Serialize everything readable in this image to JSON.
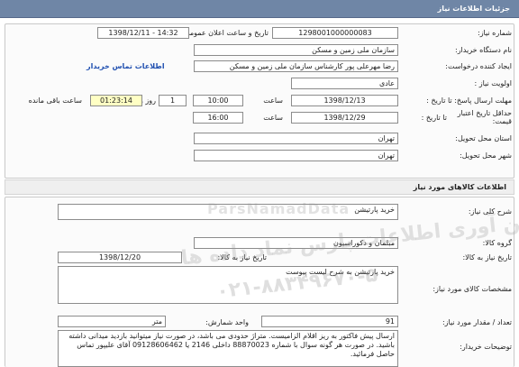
{
  "header": {
    "title": "جزئیات اطلاعات نیاز"
  },
  "fields": {
    "need_number": {
      "label": "شماره نیاز:",
      "value": "1298001000000083"
    },
    "announce": {
      "label": "تاریخ و ساعت اعلان عمومی:",
      "value": "1398/12/11 - 14:32"
    },
    "buyer": {
      "label": "نام دستگاه خریدار:",
      "value": "سازمان ملی زمین و مسکن"
    },
    "creator": {
      "label": "ایجاد کننده درخواست:",
      "value": "رضا مهرعلی پور کارشناس سازمان ملی زمین و مسکن",
      "link": "اطلاعات تماس خریدار"
    },
    "priority": {
      "label": "اولویت نیاز :",
      "value": "عادی"
    },
    "reply_deadline": {
      "label": "مهلت ارسال پاسخ: تا تاریخ :",
      "date": "1398/12/13",
      "time_label": "ساعت",
      "time": "10:00",
      "days": "1",
      "days_label": "روز و",
      "remaining": "01:23:14",
      "remaining_label": "ساعت باقی مانده"
    },
    "price_validity": {
      "label": "حداقل تاریخ اعتبار قیمت:",
      "date_label": "تا تاریخ :",
      "date": "1398/12/29",
      "time_label": "ساعت",
      "time": "16:00"
    },
    "province": {
      "label": "استان محل تحویل:",
      "value": "تهران"
    },
    "city": {
      "label": "شهر محل تحویل:",
      "value": "تهران"
    }
  },
  "goods": {
    "section_title": "اطلاعات کالاهای مورد نیاز",
    "general_desc_label": "شرح کلی نیاز:",
    "general_desc": "خرید پارتیشن",
    "group_label": "گروه کالا:",
    "group": "مبلمان و دکوراسیون",
    "need_date_label": "تاریخ نیاز به کالا:",
    "need_date": "1398/12/20",
    "spec_label": "مشخصات کالای مورد نیاز:",
    "spec": "خرید پارتیشن به شرح لیست پیوست",
    "qty_label": "تعداد / مقدار مورد نیاز:",
    "qty": "91",
    "unit_label": "واحد شمارش:",
    "unit": "متر",
    "notes_label": "توضیحات خریدار:",
    "notes": "ارسال پیش فاکتور به ریز اقلام الزامیست. متراژ حدودی می باشد، در صورت نیاز میتوانید بازدید میدانی داشته باشید. در صورت هر گونه سوال با شماره 88870023 داخلی 2146 یا 09128606462 آقای علیپور تماس حاصل فرمائید."
  },
  "watermark": {
    "line1": "فن آوری اطلاعات پارس نماد داده ها",
    "line2": "۰۲۱-۸۸۳۴۹۶۷۰-۵",
    "line3": "ParsNamadData"
  }
}
